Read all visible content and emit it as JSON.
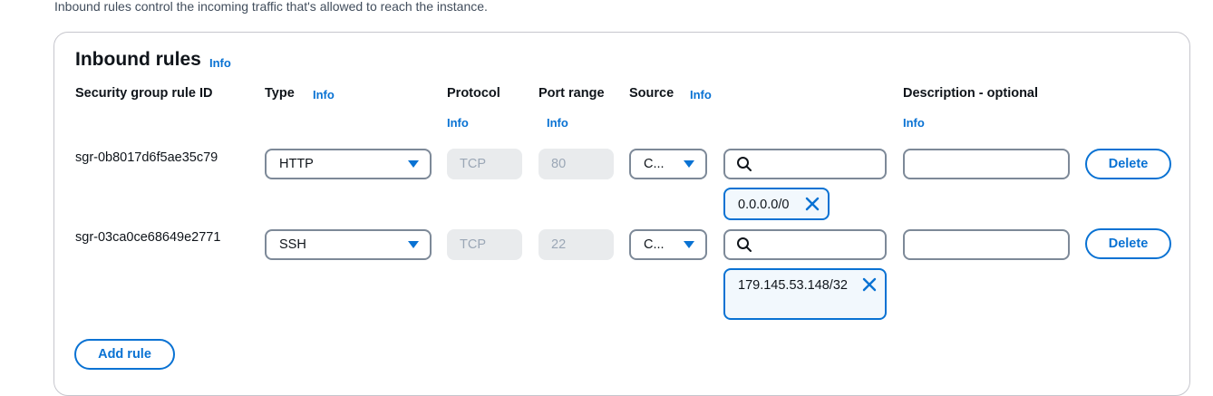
{
  "intro_text": "Inbound rules control the incoming traffic that's allowed to reach the instance.",
  "panel": {
    "title": "Inbound rules",
    "title_info": "Info"
  },
  "columns": {
    "rule_id": "Security group rule ID",
    "type": "Type",
    "type_info": "Info",
    "protocol": "Protocol",
    "protocol_info": "Info",
    "port_range": "Port range",
    "port_range_info": "Info",
    "source": "Source",
    "source_info": "Info",
    "description": "Description - optional",
    "description_info": "Info"
  },
  "rules": [
    {
      "rule_id": "sgr-0b8017d6f5ae35c79",
      "type": "HTTP",
      "protocol": "TCP",
      "port_range": "80",
      "source_type": "C...",
      "search_value": "",
      "cidr_token": "0.0.0.0/0",
      "description": "",
      "delete_label": "Delete"
    },
    {
      "rule_id": "sgr-03ca0ce68649e2771",
      "type": "SSH",
      "protocol": "TCP",
      "port_range": "22",
      "source_type": "C...",
      "search_value": "",
      "cidr_token": "179.145.53.148/32",
      "description": "",
      "delete_label": "Delete"
    }
  ],
  "add_rule_label": "Add rule",
  "icons": {
    "dropdown": "caret-down-icon",
    "search": "search-icon",
    "remove": "close-icon"
  },
  "colors": {
    "accent": "#0972d3",
    "border": "#7d8998",
    "disabled_bg": "#e9ebed",
    "token_bg": "#f2f8fd"
  }
}
